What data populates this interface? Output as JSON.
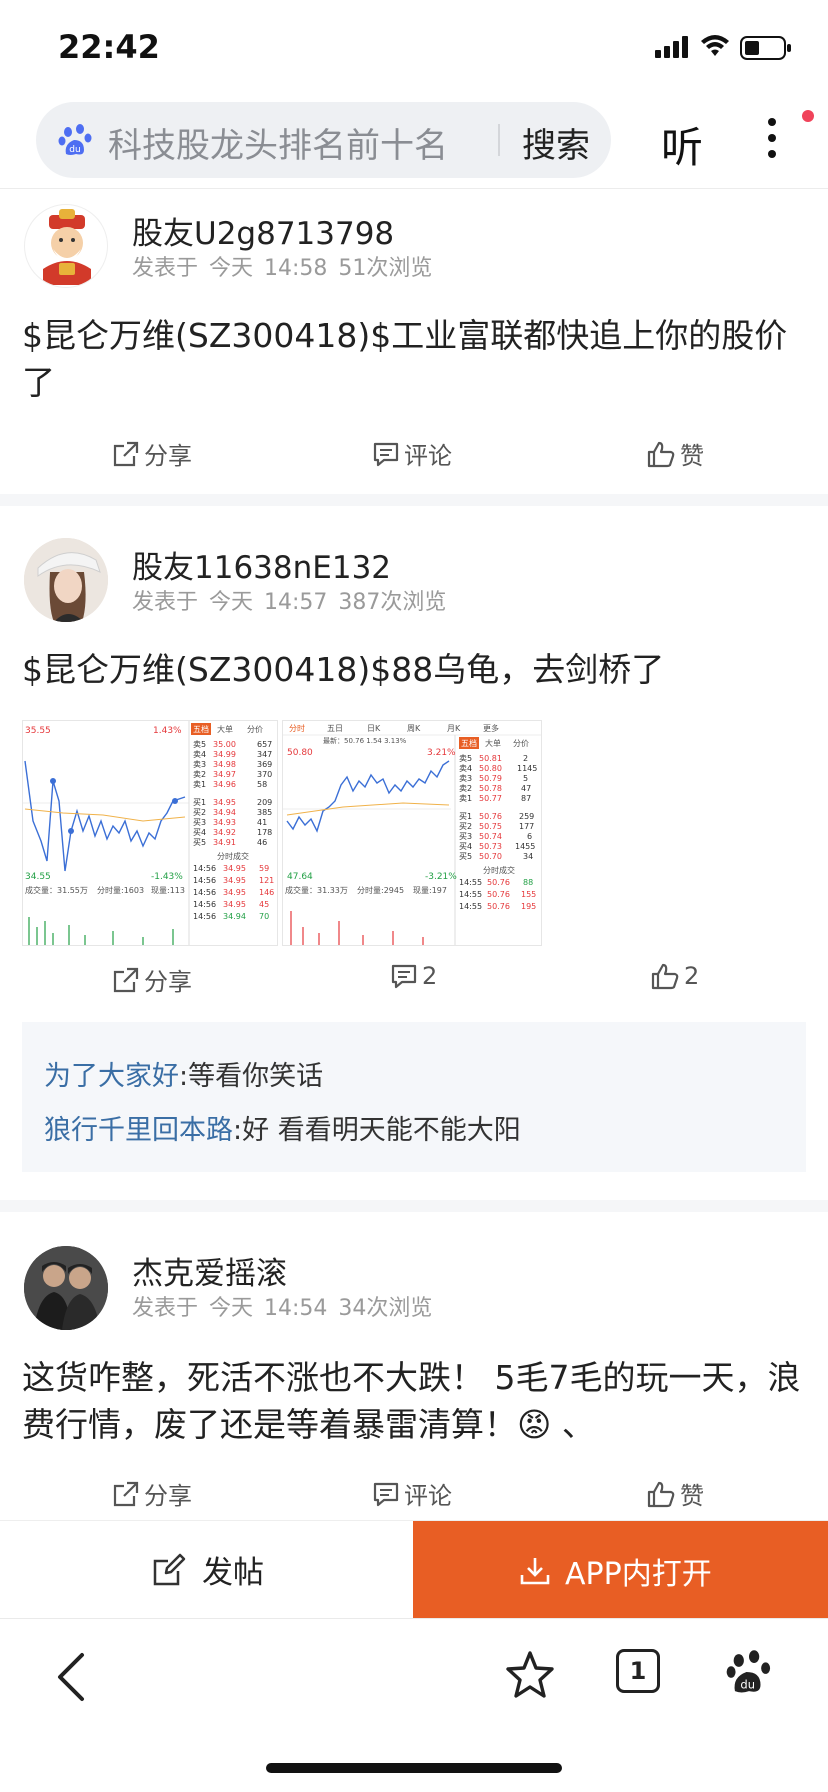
{
  "status": {
    "time": "22:42"
  },
  "search": {
    "query": "科技股龙头排名前十名",
    "button": "搜索",
    "listen": "听"
  },
  "posts": [
    {
      "user": "股友U2g8713798",
      "meta": "发表于 今天 14:58  51次浏览",
      "body": "$昆仑万维(SZ300418)$工业富联都快追上你的股价了",
      "share": "分享",
      "comment": "评论",
      "like": "赞"
    },
    {
      "user": "股友11638nE132",
      "meta": "发表于 今天 14:57  387次浏览",
      "body": "$昆仑万维(SZ300418)$88乌龟，去剑桥了",
      "share": "分享",
      "comment": "2",
      "like": "2",
      "comments": [
        {
          "user": "为了大家好",
          "text": "等看你笑话"
        },
        {
          "user": "狼行千里回本路",
          "text": "好 看看明天能不能大阳"
        }
      ],
      "chart1": {
        "price_top": "35.55",
        "pct_top": "1.43%",
        "price_bot": "34.55",
        "pct_bot": "-1.43%",
        "tab": "五档",
        "hdr": [
          "大单",
          "分价"
        ],
        "sells": [
          [
            "卖5",
            "35.00",
            "657"
          ],
          [
            "卖4",
            "34.99",
            "347"
          ],
          [
            "卖3",
            "34.98",
            "369"
          ],
          [
            "卖2",
            "34.97",
            "370"
          ],
          [
            "卖1",
            "34.96",
            "58"
          ]
        ],
        "buys": [
          [
            "买1",
            "34.95",
            "209"
          ],
          [
            "买2",
            "34.94",
            "385"
          ],
          [
            "买3",
            "34.93",
            "41"
          ],
          [
            "买4",
            "34.92",
            "178"
          ],
          [
            "买5",
            "34.91",
            "46"
          ]
        ],
        "ticks_title": "分时成交",
        "ticks": [
          [
            "14:56",
            "34.95",
            "59"
          ],
          [
            "14:56",
            "34.95",
            "121"
          ],
          [
            "14:56",
            "34.95",
            "146"
          ],
          [
            "14:56",
            "34.95",
            "45"
          ],
          [
            "14:56",
            "34.94",
            "70"
          ]
        ],
        "vol": "成交量：31.55万",
        "fenshi": "分时量:1603",
        "xianliang": "现量:113"
      },
      "chart2": {
        "tabs": [
          "分时",
          "五日",
          "日K",
          "周K",
          "月K",
          "更多"
        ],
        "price_top": "50.80",
        "pct_top": "3.21%",
        "latest": "最新：50.76 1.54 3.13%",
        "price_bot": "47.64",
        "pct_bot": "-3.21%",
        "tab": "五档",
        "hdr": [
          "大单",
          "分价"
        ],
        "sells": [
          [
            "卖5",
            "50.81",
            "2"
          ],
          [
            "卖4",
            "50.80",
            "1145"
          ],
          [
            "卖3",
            "50.79",
            "5"
          ],
          [
            "卖2",
            "50.78",
            "47"
          ],
          [
            "卖1",
            "50.77",
            "87"
          ]
        ],
        "buys": [
          [
            "买1",
            "50.76",
            "259"
          ],
          [
            "买2",
            "50.75",
            "177"
          ],
          [
            "买3",
            "50.74",
            "6"
          ],
          [
            "买4",
            "50.73",
            "1455"
          ],
          [
            "买5",
            "50.70",
            "34"
          ]
        ],
        "ticks_title": "分时成交",
        "ticks": [
          [
            "14:55",
            "50.76",
            "88"
          ],
          [
            "14:55",
            "50.76",
            "155"
          ],
          [
            "14:55",
            "50.76",
            "195"
          ]
        ],
        "vol": "成交量：31.33万",
        "fenshi": "分时量:2945",
        "xianliang": "现量:197"
      }
    },
    {
      "user": "杰克爱摇滚",
      "meta": "发表于 今天 14:54  34次浏览",
      "body": "这货咋整，死活不涨也不大跌！ 5毛7毛的玩一天，浪费行情，废了还是等着暴雷清算！😡 、",
      "share": "分享",
      "comment": "评论",
      "like": "赞"
    }
  ],
  "bottom": {
    "post": "发帖",
    "open_app": "APP内打开"
  },
  "nav": {
    "tabs_count": "1"
  },
  "colors": {
    "accent": "#e85e24",
    "link": "#3a6ea5",
    "red": "#e5383b",
    "green": "#23a046"
  }
}
